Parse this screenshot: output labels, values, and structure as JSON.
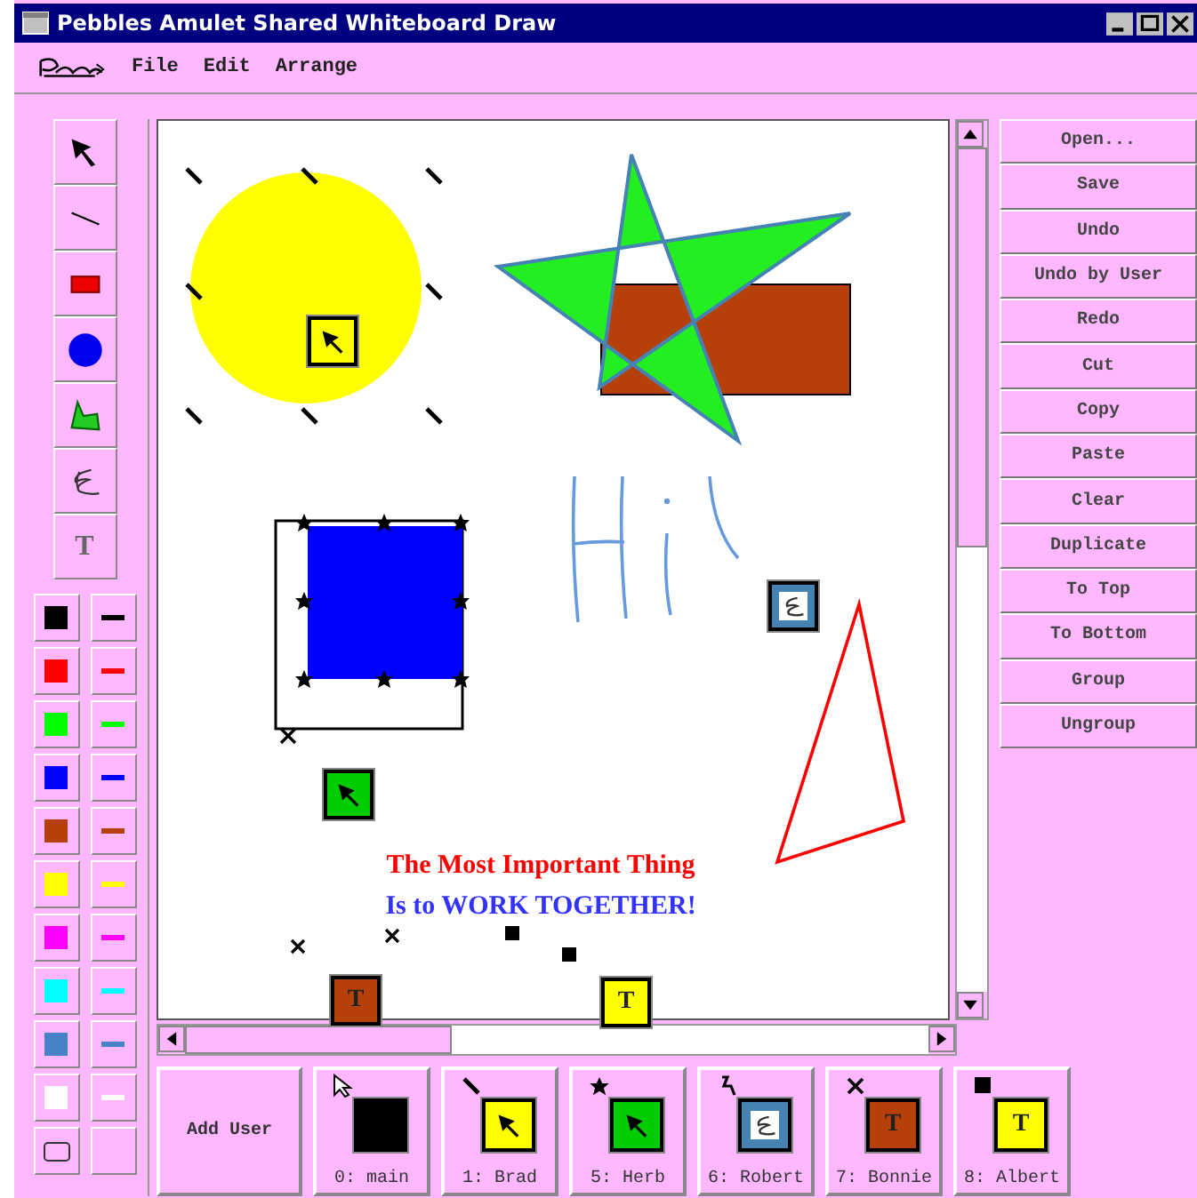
{
  "window": {
    "title": "Pebbles Amulet Shared Whiteboard Draw"
  },
  "menu": [
    "File",
    "Edit",
    "Arrange"
  ],
  "tools": [
    {
      "kind": "select"
    },
    {
      "kind": "line"
    },
    {
      "kind": "rect"
    },
    {
      "kind": "ellipse"
    },
    {
      "kind": "polygon"
    },
    {
      "kind": "freehand"
    },
    {
      "kind": "text",
      "glyph": "T"
    }
  ],
  "palette": [
    {
      "color": "#000000"
    },
    {
      "color": "#ff0000"
    },
    {
      "color": "#00ff00"
    },
    {
      "color": "#0000ff"
    },
    {
      "color": "#b5400a"
    },
    {
      "color": "#ffff00"
    },
    {
      "color": "#ff00ff"
    },
    {
      "color": "#00ffff"
    },
    {
      "color": "#4682c8"
    },
    {
      "color": "#ffffff"
    }
  ],
  "canvas": {
    "texts": [
      {
        "text": "The Most Important Thing",
        "color": "#ff0000"
      },
      {
        "text": "Is to WORK TOGETHER!",
        "color": "#3333ff"
      }
    ],
    "cursors": [
      {
        "kind": "select",
        "color": "#ffff00"
      },
      {
        "kind": "freehand",
        "color": "#4682b4"
      },
      {
        "kind": "select",
        "color": "#00cc00"
      },
      {
        "kind": "text",
        "color": "#b5400a",
        "glyph": "T"
      },
      {
        "kind": "text",
        "color": "#ffff00",
        "glyph": "T"
      }
    ]
  },
  "actions": [
    "Open...",
    "Save",
    "Undo",
    "Undo by User",
    "Redo",
    "Cut",
    "Copy",
    "Paste",
    "Clear",
    "Duplicate",
    "To Top",
    "To Bottom",
    "Group",
    "Ungroup"
  ],
  "add_user": "Add User",
  "users": [
    {
      "label": "0: main",
      "marker": {
        "kind": "pointer"
      },
      "badge": {
        "kind": "plain",
        "color": "#000000"
      }
    },
    {
      "label": "1: Brad",
      "marker": {
        "kind": "pen"
      },
      "badge": {
        "kind": "select",
        "color": "#ffff00"
      }
    },
    {
      "label": "5: Herb",
      "marker": {
        "kind": "star"
      },
      "badge": {
        "kind": "select",
        "color": "#00cc00"
      }
    },
    {
      "label": "6: Robert",
      "marker": {
        "kind": "hook"
      },
      "badge": {
        "kind": "freehand",
        "color": "#4682b4"
      }
    },
    {
      "label": "7: Bonnie",
      "marker": {
        "kind": "cross"
      },
      "badge": {
        "kind": "text",
        "color": "#b5400a",
        "glyph": "T"
      }
    },
    {
      "label": "8: Albert",
      "marker": {
        "kind": "square"
      },
      "badge": {
        "kind": "text",
        "color": "#ffff00",
        "glyph": "T"
      }
    }
  ]
}
